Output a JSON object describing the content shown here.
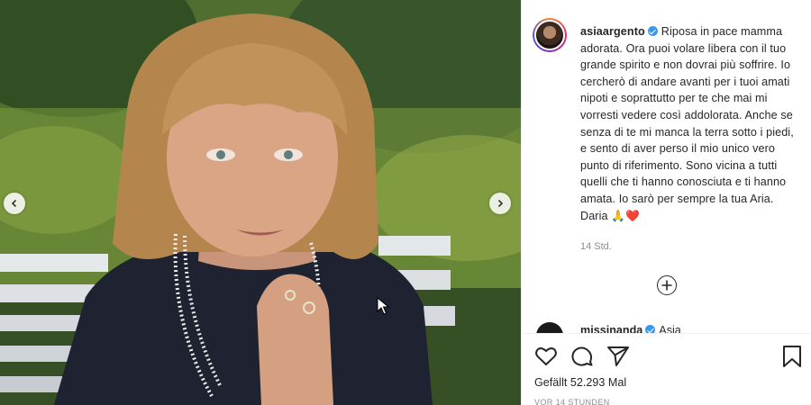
{
  "post": {
    "username": "asiaargento",
    "caption": "Riposa in pace mamma adorata. Ora puoi volare libera con il tuo grande spirito e non dovrai più soffrire. Io cercherò di andare avanti per i tuoi amati nipoti e soprattutto per te che mai mi vorresti vedere così addolorata. Anche se senza di te mi manca la terra sotto i piedi, e sento di aver perso il mio unico vero punto di riferimento. Sono vicina a tutti quelli che ti hanno conosciuta e ti hanno amata. Io sarò per sempre la tua Aria. Daria 🙏❤️",
    "time_ago": "14 Std.",
    "likes_label": "Gefällt 52.293 Mal",
    "timestamp": "VOR 14 STUNDEN"
  },
  "comment_preview": {
    "username": "missinanda",
    "text": "Asia"
  },
  "icons": {
    "prev": "chevron-left-icon",
    "next": "chevron-right-icon",
    "load_more": "plus-circle-icon",
    "like": "heart-icon",
    "comment": "comment-bubble-icon",
    "share": "paper-plane-icon",
    "save": "bookmark-icon"
  },
  "colors": {
    "verified": "#3897f0",
    "text": "#262626",
    "muted": "#8e8e8e"
  }
}
